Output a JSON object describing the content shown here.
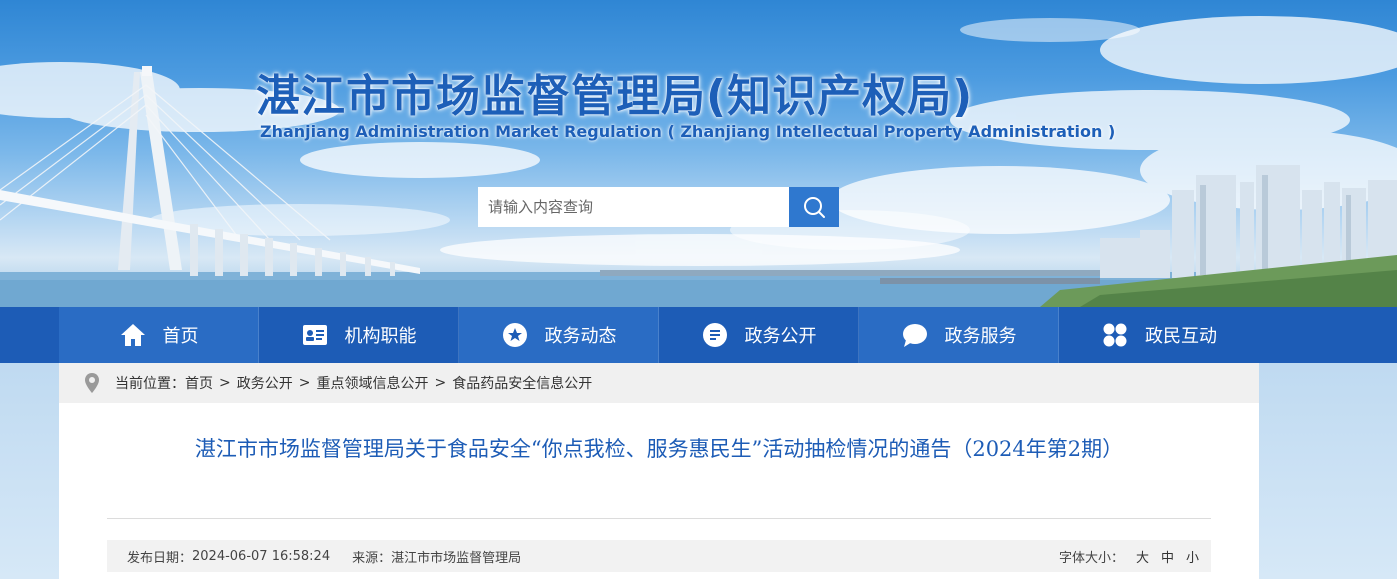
{
  "site": {
    "title": "湛江市市场监督管理局(知识产权局)",
    "subtitle": "Zhanjiang Administration Market Regulation ( Zhanjiang Intellectual Property Administration )"
  },
  "search": {
    "placeholder": "请输入内容查询",
    "button_icon": "search-icon"
  },
  "nav": {
    "items": [
      {
        "label": "首页",
        "icon": "home-icon"
      },
      {
        "label": "机构职能",
        "icon": "id-card-icon"
      },
      {
        "label": "政务动态",
        "icon": "star-circle-icon"
      },
      {
        "label": "政务公开",
        "icon": "document-icon"
      },
      {
        "label": "政务服务",
        "icon": "chat-bubble-icon"
      },
      {
        "label": "政民互动",
        "icon": "grid-icon"
      }
    ]
  },
  "breadcrumb": {
    "prefix": "当前位置：",
    "items": [
      "首页",
      "政务公开",
      "重点领域信息公开",
      "食品药品安全信息公开"
    ],
    "separator": ">"
  },
  "article": {
    "title": "湛江市市场监督管理局关于食品安全“你点我检、服务惠民生”活动抽检情况的通告（2024年第2期）",
    "publish_label": "发布日期：",
    "publish_date": "2024-06-07 16:58:24",
    "source_label": "来源：",
    "source": "湛江市市场监督管理局",
    "font_size_label": "字体大小：",
    "font_sizes": [
      "大",
      "中",
      "小"
    ]
  },
  "colors": {
    "nav_bg": "#1d5cb6",
    "nav_alt_bg": "#2a6cc4",
    "title_blue": "#1d5fb8",
    "search_button": "#2f78cf",
    "breadcrumb_bg": "#f0f0f0",
    "meta_bg": "#f2f2f2"
  }
}
